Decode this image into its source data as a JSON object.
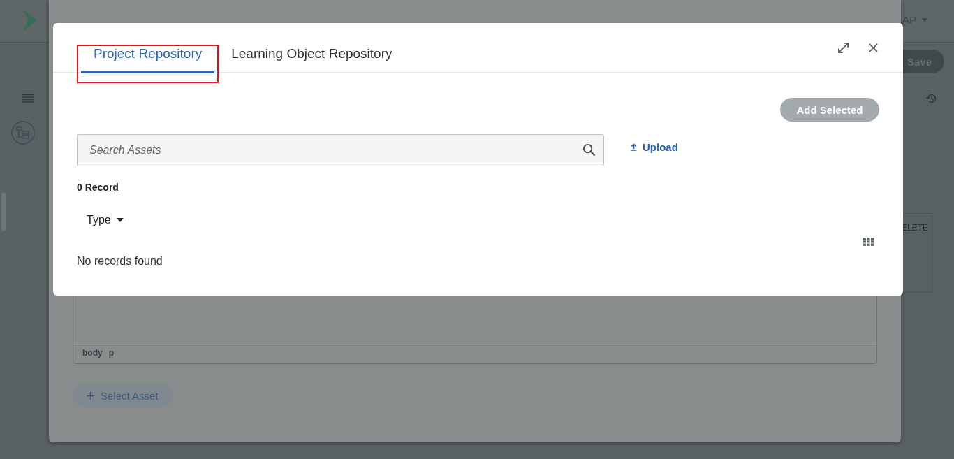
{
  "background": {
    "user_menu": "AP",
    "save_button": "Save",
    "delete_label": "ELETE"
  },
  "back_dialog": {
    "editor_path": [
      "body",
      "p"
    ],
    "select_asset_button": "Select Asset"
  },
  "dialog": {
    "tabs": [
      {
        "label": "Project Repository",
        "selected": true,
        "highlighted": true
      },
      {
        "label": "Learning Object Repository",
        "selected": false,
        "highlighted": false
      }
    ],
    "add_selected_button": {
      "label": "Add Selected",
      "disabled": true
    },
    "search": {
      "placeholder": "Search Assets"
    },
    "upload_link": "Upload",
    "record_count": "0 Record",
    "type_filter": "Type",
    "empty_message": "No records found"
  }
}
